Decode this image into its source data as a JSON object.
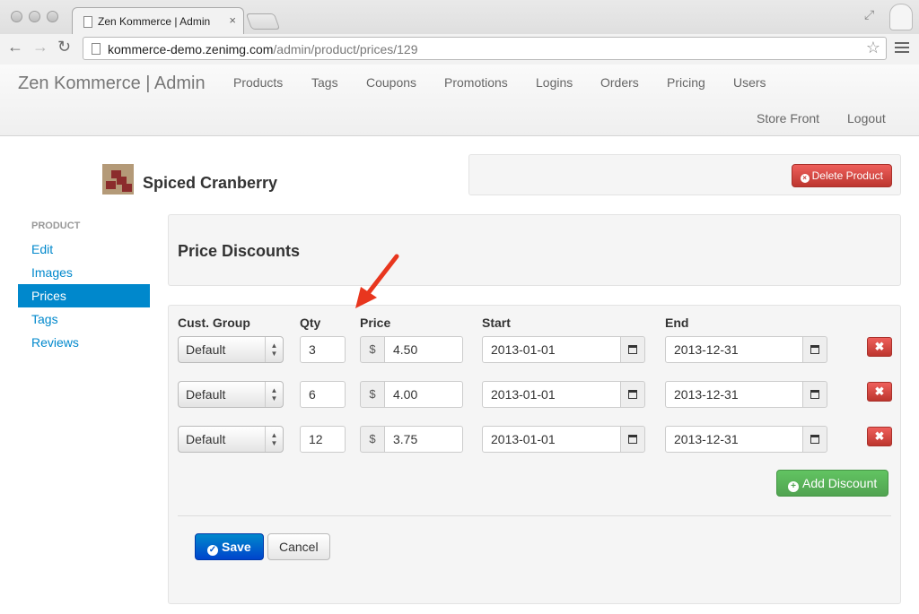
{
  "browser": {
    "tab_title": "Zen Kommerce | Admin",
    "url_domain": "kommerce-demo.zenimg.com",
    "url_path": "/admin/product/prices/129",
    "close_glyph": "×",
    "back_glyph": "←",
    "forward_glyph": "→",
    "reload_glyph": "↻",
    "star_glyph": "☆",
    "resize_glyph": "⤢"
  },
  "navbar": {
    "brand": "Zen Kommerce | Admin",
    "links": [
      "Products",
      "Tags",
      "Coupons",
      "Promotions",
      "Logins",
      "Orders",
      "Pricing",
      "Users"
    ],
    "right_links": [
      "Store Front",
      "Logout"
    ]
  },
  "product": {
    "name": "Spiced Cranberry",
    "delete_label": "Delete Product"
  },
  "sidebar": {
    "header": "PRODUCT",
    "items": [
      "Edit",
      "Images",
      "Prices",
      "Tags",
      "Reviews"
    ],
    "active": "Prices"
  },
  "discounts": {
    "title": "Price Discounts",
    "columns": {
      "group": "Cust. Group",
      "qty": "Qty",
      "price": "Price",
      "start": "Start",
      "end": "End"
    },
    "currency_symbol": "$",
    "rows": [
      {
        "group": "Default",
        "qty": "3",
        "price": "4.50",
        "start": "2013-01-01",
        "end": "2013-12-31"
      },
      {
        "group": "Default",
        "qty": "6",
        "price": "4.00",
        "start": "2013-01-01",
        "end": "2013-12-31"
      },
      {
        "group": "Default",
        "qty": "12",
        "price": "3.75",
        "start": "2013-01-01",
        "end": "2013-12-31"
      }
    ],
    "remove_glyph": "✖",
    "add_label": "Add Discount",
    "save_label": "Save",
    "cancel_label": "Cancel"
  },
  "colors": {
    "primary": "#0088cc",
    "danger": "#bd362f",
    "success": "#51a351",
    "annotation_arrow": "#e8361e"
  },
  "icons": {
    "calendar": "calendar-icon",
    "delete": "remove-circle-icon",
    "add": "plus-circle-icon",
    "save": "check-circle-icon"
  }
}
